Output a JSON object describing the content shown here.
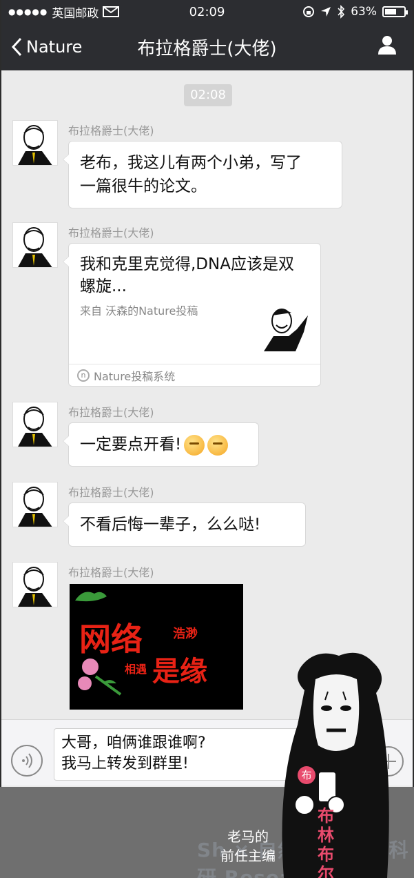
{
  "status": {
    "carrier": "英国邮政",
    "time": "02:09",
    "battery": "63%",
    "battery_level": 0.63
  },
  "nav": {
    "back_label": "Nature",
    "title": "布拉格爵士(大佬)"
  },
  "chat": {
    "timestamp": "02:08",
    "messages": [
      {
        "sender": "布拉格爵士(大佬)",
        "text": "老布，我这儿有两个小弟，写了\n一篇很牛的论文。"
      },
      {
        "sender": "布拉格爵士(大佬)",
        "card_title": "我和克里克觉得,DNA应该是双螺旋...",
        "card_sub": "来自 沃森的Nature投稿",
        "card_footer": "Nature投稿系统"
      },
      {
        "sender": "布拉格爵士(大佬)",
        "text": "一定要点开看!"
      },
      {
        "sender": "布拉格爵士(大佬)",
        "text": "不看后悔一辈子，么么哒!"
      },
      {
        "sender": "布拉格爵士(大佬)",
        "image_text_1": "网络",
        "image_text_2": "浩渺",
        "image_text_3": "相遇",
        "image_text_4": "是缘"
      }
    ]
  },
  "input": {
    "draft": "大哥，咱俩谁跟谁啊?\n我马上转发到群里!"
  },
  "overlay": {
    "caption_line1": "老马的",
    "caption_line2": "前任主编",
    "name_vertical": "布林布尔",
    "badge": "布",
    "watermark": "Sh × 自然 nature 科研 Research"
  },
  "colors": {
    "bar": "#2c2d31",
    "chat_bg": "#ebebeb",
    "accent_red": "#e82215",
    "pink": "#e84b6d"
  }
}
